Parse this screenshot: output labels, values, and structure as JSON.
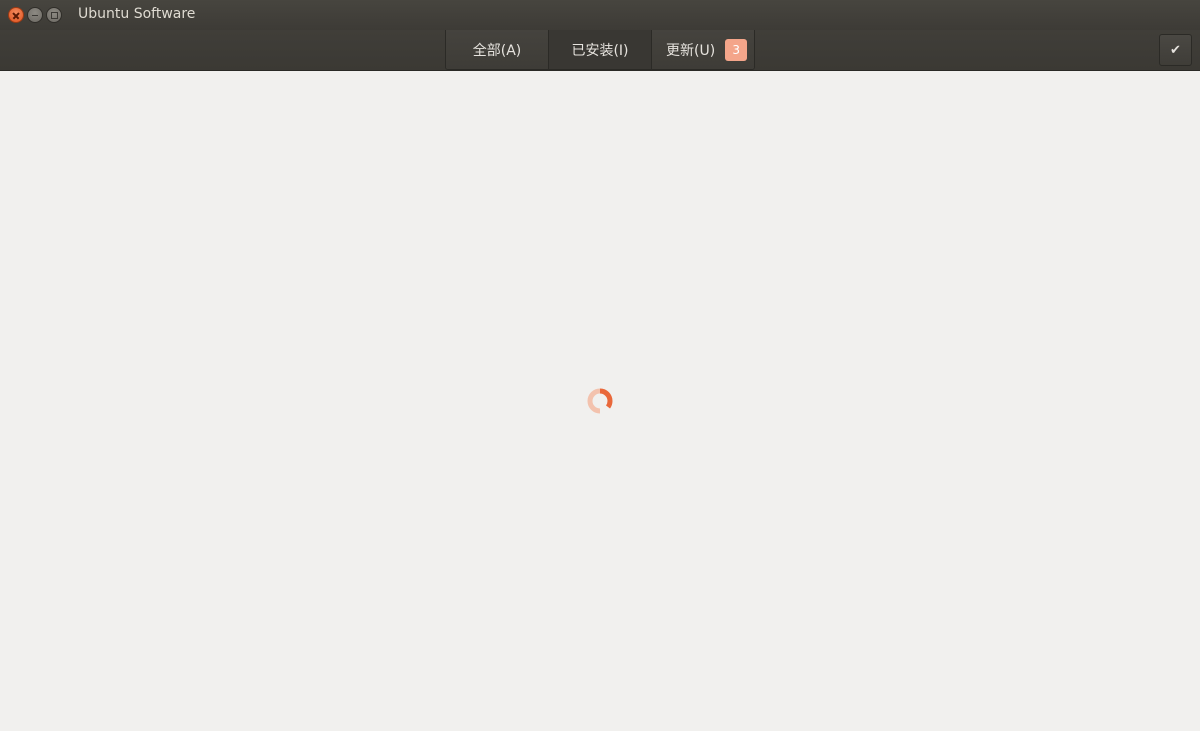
{
  "window": {
    "title": "Ubuntu Software"
  },
  "tabs": [
    {
      "label": "全部(A)"
    },
    {
      "label": "已安装(I)"
    },
    {
      "label": "更新(U)",
      "badge": "3"
    }
  ],
  "toolbar": {
    "select_icon": "checkmark-icon"
  },
  "colors": {
    "accent": "#e95420",
    "badge": "#f4a58a",
    "titlebar": "#3d3b36",
    "content_bg": "#f1f0ee"
  }
}
